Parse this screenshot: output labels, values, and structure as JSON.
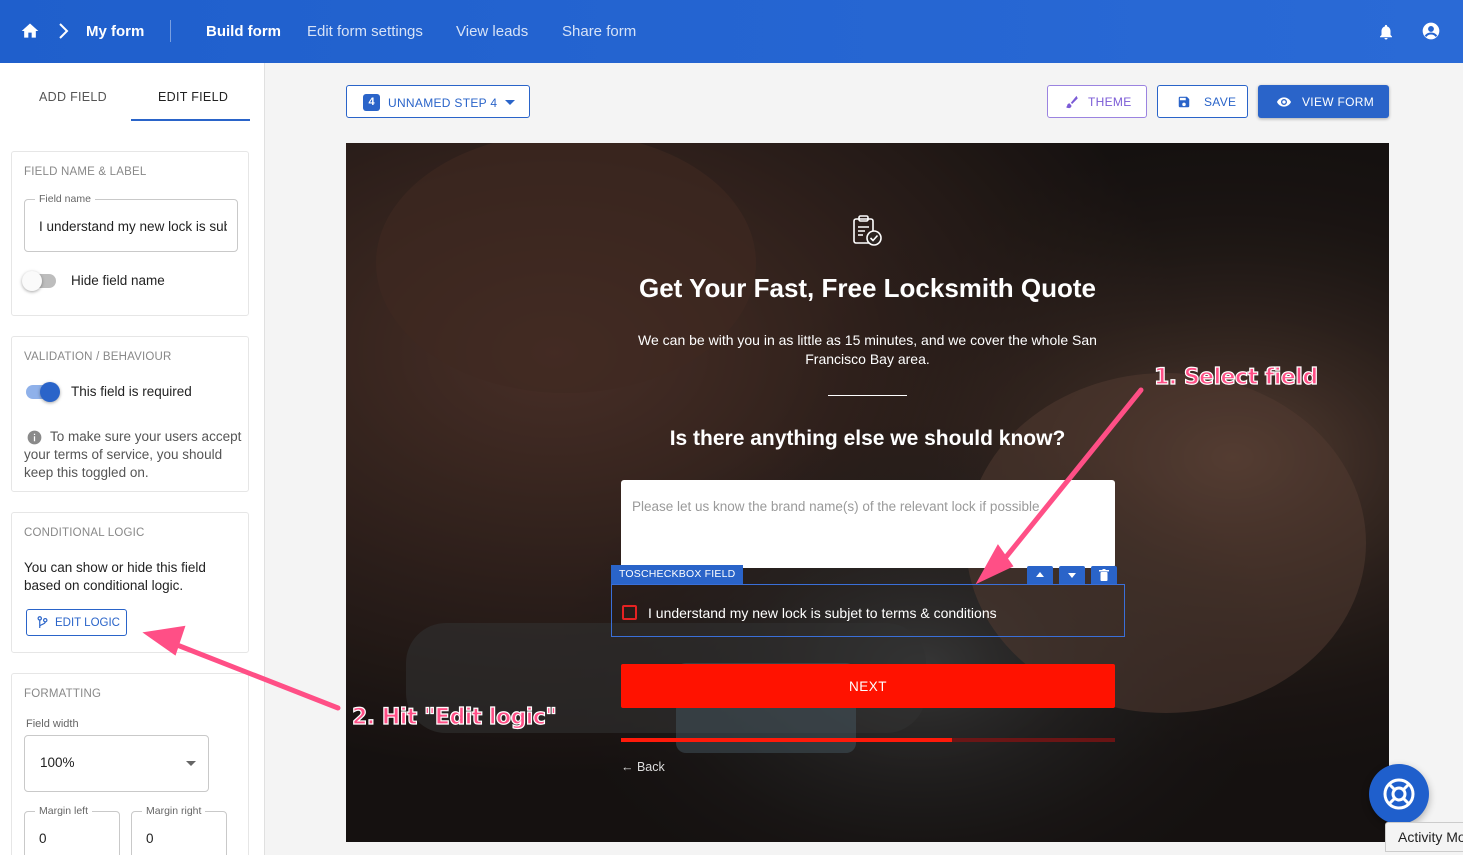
{
  "topbar": {
    "breadcrumb": "My form",
    "nav": [
      "Build form",
      "Edit form settings",
      "View leads",
      "Share form"
    ],
    "active_nav": "Build form"
  },
  "sidebar": {
    "tabs": [
      "ADD FIELD",
      "EDIT FIELD"
    ],
    "active_tab": "EDIT FIELD",
    "field_name_section": {
      "title": "FIELD NAME & LABEL",
      "field_name_label": "Field name",
      "field_name_value": "I understand my new lock is subjet to terms & conditions",
      "hide_toggle_label": "Hide field name",
      "hide_toggle_on": false
    },
    "validation_section": {
      "title": "VALIDATION / BEHAVIOUR",
      "required_label": "This field is required",
      "required_on": true,
      "info_text": "To make sure your users accept your terms of service, you should keep this toggled on."
    },
    "logic_section": {
      "title": "CONDITIONAL LOGIC",
      "description": "You can show or hide this field based on conditional logic.",
      "button_label": "EDIT LOGIC"
    },
    "formatting_section": {
      "title": "FORMATTING",
      "width_label": "Field width",
      "width_value": "100%",
      "margin_left_label": "Margin left",
      "margin_left_value": "0",
      "margin_right_label": "Margin right",
      "margin_right_value": "0"
    }
  },
  "toolbar": {
    "step_number": "4",
    "step_label": "UNNAMED STEP 4",
    "theme_label": "THEME",
    "save_label": "SAVE",
    "view_form_label": "VIEW FORM"
  },
  "form_preview": {
    "title": "Get Your Fast, Free Locksmith Quote",
    "subtitle_line1": "We can be with you in as little as 15 minutes, and we cover the whole San",
    "subtitle_line2": "Francisco Bay area.",
    "question": "Is there anything else we should know?",
    "textarea_placeholder": "Please let us know the brand name(s) of the relevant lock if possible",
    "selected_field_tag": "TOSCHECKBOX FIELD",
    "tos_text": "I understand my new lock is subjet to terms & conditions",
    "tos_checked": false,
    "next_label": "NEXT",
    "progress": 0.67,
    "back_label": "← Back"
  },
  "annotations": {
    "select_field": "1. Select field",
    "hit_edit_logic": "2. Hit \"Edit logic\""
  },
  "activity_tab": "Activity Mo",
  "colors": {
    "primary": "#2a64c9",
    "next_button": "#ff1200",
    "annotation": "#ff4f86",
    "theme_purple": "#7b5bd6"
  },
  "icons": [
    "home-icon",
    "chevron-right-icon",
    "bell-icon",
    "account-icon",
    "brush-icon",
    "save-icon",
    "eye-icon",
    "info-icon",
    "branch-icon",
    "clipboard-check-icon",
    "arrow-up-icon",
    "arrow-down-icon",
    "trash-icon",
    "lifebuoy-icon"
  ]
}
